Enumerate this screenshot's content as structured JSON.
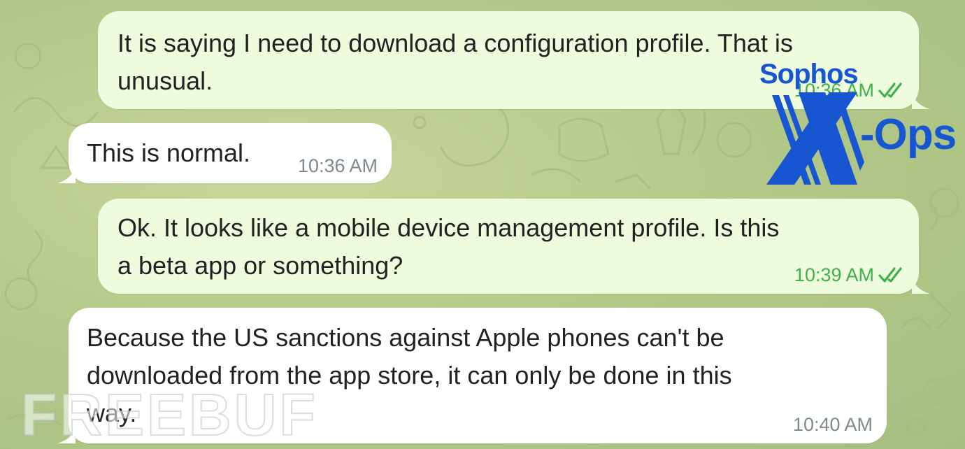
{
  "messages": [
    {
      "direction": "outgoing",
      "text_line1": "It is saying I need to download a configuration profile. That is",
      "text_line2": "unusual.",
      "time": "10:36 AM",
      "read": true
    },
    {
      "direction": "incoming",
      "text_line1": "This is normal.",
      "time": "10:36 AM"
    },
    {
      "direction": "outgoing",
      "text_line1": "Ok. It looks like a mobile device management profile. Is this",
      "text_line2": "a beta app or something?",
      "time": "10:39 AM",
      "read": true
    },
    {
      "direction": "incoming",
      "text_line1": "Because the US sanctions against Apple phones can't be",
      "text_line2": "downloaded from the app store, it can only be done in this",
      "text_line3": "way.",
      "time": "10:40 AM"
    }
  ],
  "logo": {
    "brand": "Sophos",
    "product": "-Ops",
    "color": "#1755d1"
  },
  "watermark": "FREEBUF",
  "colors": {
    "outgoing_bubble": "#eefcdd",
    "incoming_bubble": "#ffffff",
    "read_ticks": "#3fb04c",
    "wallpaper": "#b4c98a"
  },
  "icons": {
    "read_receipt": "double-check-icon"
  }
}
